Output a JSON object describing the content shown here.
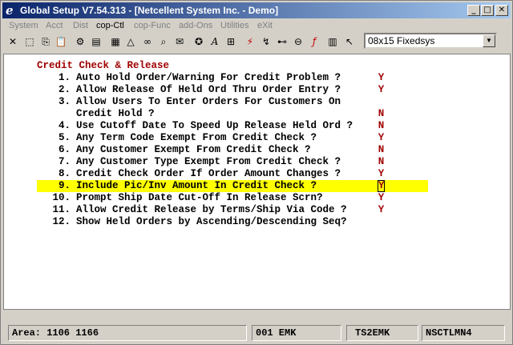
{
  "window": {
    "title": "Global Setup V7.54.313 - [Netcellent System Inc. - Demo]",
    "controls": {
      "minimize": "_",
      "maximize": "□",
      "close": "✕"
    }
  },
  "menu": [
    "System",
    "Acct",
    "Dist",
    "cop-Ctl",
    "cop-Func",
    "add-Ons",
    "Utilities",
    "eXit"
  ],
  "toolbar": {
    "icons": [
      "close-icon",
      "select-icon",
      "copy-icon",
      "paste-icon",
      "gear-icon",
      "settings-icon",
      "note-icon",
      "bell-icon",
      "binoculars-icon",
      "zoom-icon",
      "mail-icon",
      "font-icon",
      "graph-icon",
      "lightning-icon",
      "calc-icon",
      "link-icon",
      "function-icon",
      "list-icon",
      "help-pointer-icon"
    ],
    "font_value": "08x15 Fixedsys"
  },
  "screen": {
    "heading": "Credit Check & Release",
    "items": [
      {
        "num": "1.",
        "label": "Auto Hold Order/Warning For Credit Problem ?",
        "value": "Y"
      },
      {
        "num": "2.",
        "label": "Allow Release Of Held Ord Thru Order Entry ?",
        "value": "Y"
      },
      {
        "num": "3.",
        "label": "Allow Users To Enter Orders For Customers On",
        "continuation": "Credit Hold ?",
        "value": "N"
      },
      {
        "num": "4.",
        "label": "Use Cutoff Date To Speed Up Release Held Ord ?",
        "value": "N"
      },
      {
        "num": "5.",
        "label": "Any Term Code Exempt From Credit Check ?",
        "value": "Y"
      },
      {
        "num": "6.",
        "label": "Any Customer Exempt From Credit Check ?",
        "value": "N"
      },
      {
        "num": "7.",
        "label": "Any Customer Type Exempt From Credit Check ?",
        "value": "N"
      },
      {
        "num": "8.",
        "label": "Credit Check Order If Order Amount Changes ?",
        "value": "Y"
      },
      {
        "num": "9.",
        "label": "Include Pic/Inv Amount In Credit Check ?",
        "value": "Y"
      },
      {
        "num": "10.",
        "label": "Prompt Ship Date Cut-Off In Release Scrn?",
        "value": "Y"
      },
      {
        "num": "11.",
        "label": "Allow Credit Release by Terms/Ship Via Code ?",
        "value": "Y"
      },
      {
        "num": "12.",
        "label": "Show Held Orders by Ascending/Descending Seq?",
        "value": ""
      }
    ]
  },
  "status": {
    "area": "Area: 1106 1166",
    "user": "001 EMK",
    "company": "TS2EMK",
    "program": "NSCTLMN4"
  }
}
